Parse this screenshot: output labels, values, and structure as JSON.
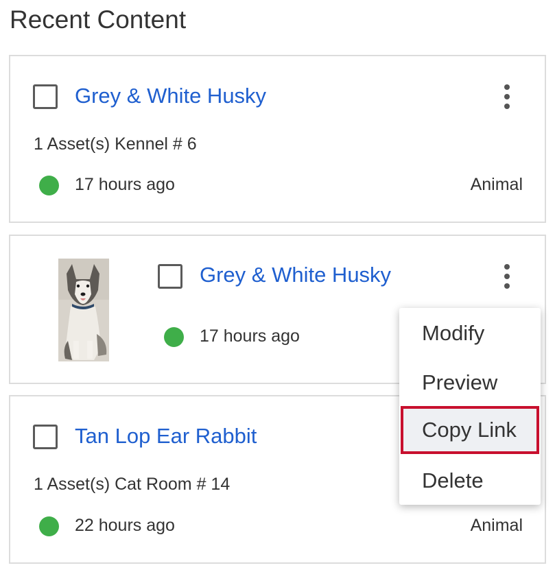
{
  "page": {
    "title": "Recent Content"
  },
  "colors": {
    "link": "#1f5fcf",
    "status_active": "#3fae49",
    "highlight_border": "#c8102e"
  },
  "cards": [
    {
      "title": "Grey & White Husky",
      "meta": "1 Asset(s) Kennel # 6",
      "time": "17 hours ago",
      "type": "Animal",
      "has_thumbnail": false
    },
    {
      "title": "Grey & White Husky",
      "time": "17 hours ago",
      "has_thumbnail": true,
      "thumbnail_icon": "husky-photo"
    },
    {
      "title": "Tan Lop Ear Rabbit",
      "meta": "1 Asset(s) Cat Room # 14",
      "time": "22 hours ago",
      "type": "Animal",
      "has_thumbnail": false
    }
  ],
  "context_menu": {
    "items": [
      {
        "label": "Modify"
      },
      {
        "label": "Preview"
      },
      {
        "label": "Copy Link",
        "highlighted": true
      },
      {
        "label": "Delete"
      }
    ]
  }
}
